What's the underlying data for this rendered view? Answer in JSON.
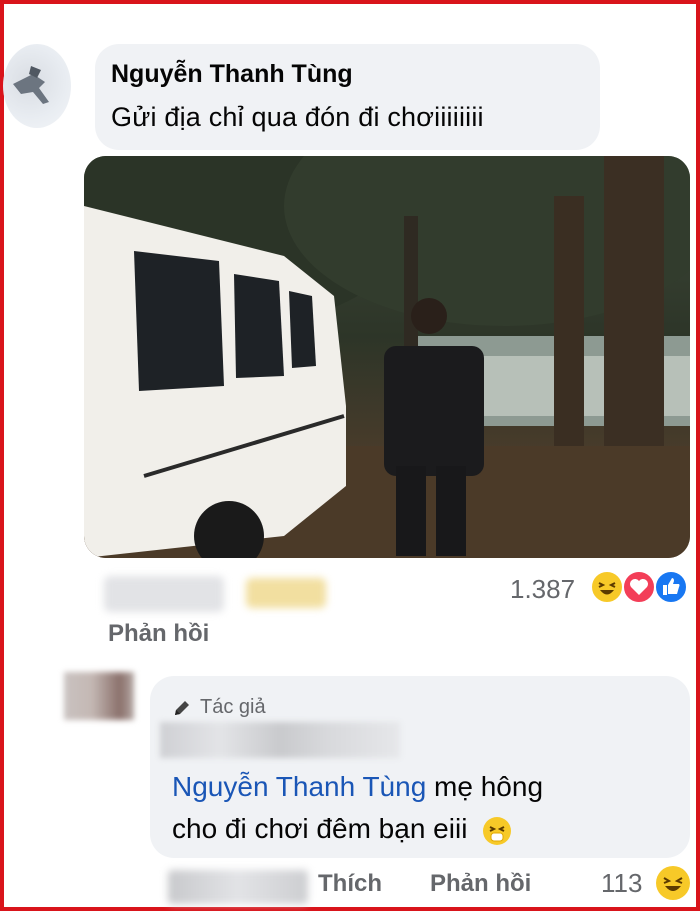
{
  "comment": {
    "author": "Nguyễn Thanh Tùng",
    "text": "Gửi địa chỉ qua đón đi chơiiiiiiii",
    "reaction_count": "1.387",
    "reactions": [
      "haha-icon",
      "love-icon",
      "like-icon"
    ],
    "reply_label": "Phản hồi"
  },
  "reply": {
    "badge_label": "Tác giả",
    "mention": "Nguyễn Thanh Tùng",
    "text_line1": " mẹ hông",
    "text_line2": "cho đi chơi đêm bạn eiii",
    "like_label": "Thích",
    "reply_label": "Phản hồi",
    "reaction_count": "113",
    "reactions": [
      "haha-icon"
    ]
  },
  "colors": {
    "frame": "#d9141b",
    "bubble": "#f0f2f5",
    "mention": "#1a56b6",
    "meta_text": "#65676b"
  }
}
